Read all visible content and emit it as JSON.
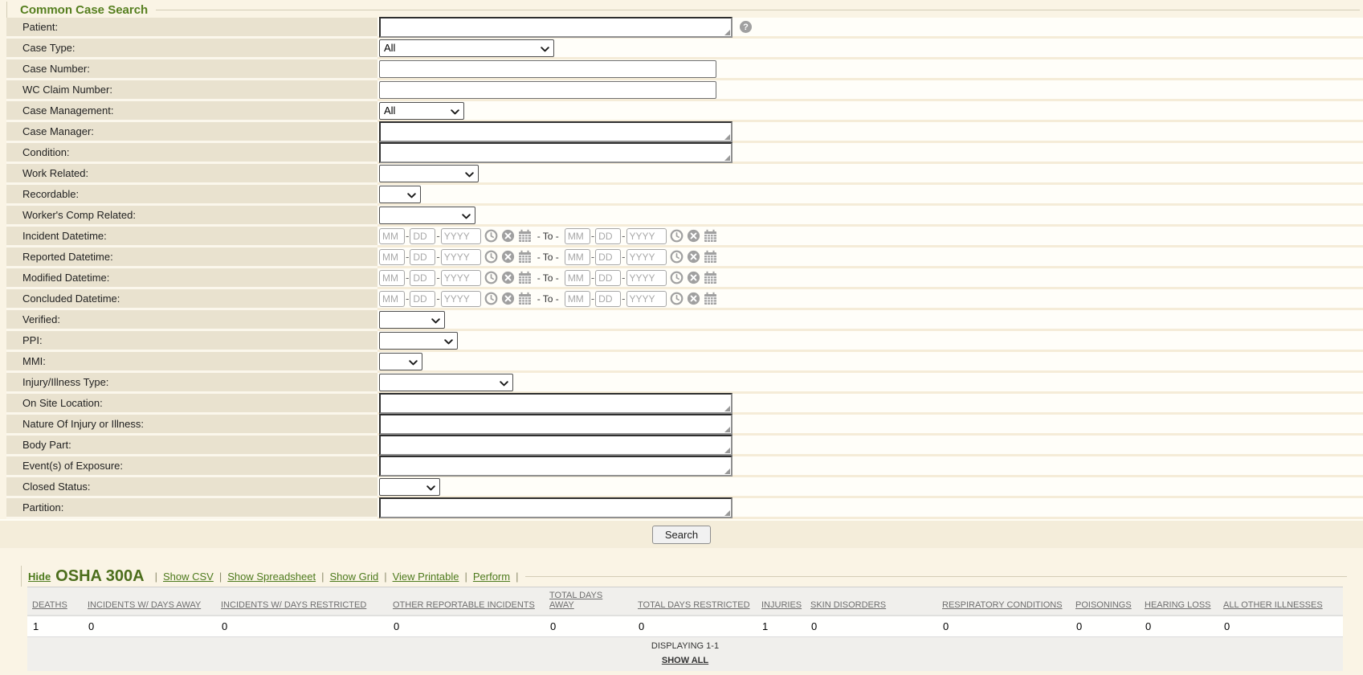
{
  "header": {
    "title": "Common Case Search"
  },
  "form": {
    "search_button": "Search",
    "help_icon": "?",
    "date_placeholders": {
      "mm": "MM",
      "dd": "DD",
      "yyyy": "YYYY"
    },
    "date_separator": "- To -",
    "dash": "-",
    "rows": [
      {
        "id": "patient",
        "label": "Patient:",
        "type": "textarea",
        "value": "",
        "help": true
      },
      {
        "id": "case_type",
        "label": "Case Type:",
        "type": "select",
        "value": "All"
      },
      {
        "id": "case_number",
        "label": "Case Number:",
        "type": "input",
        "value": ""
      },
      {
        "id": "wc_claim_number",
        "label": "WC Claim Number:",
        "type": "input",
        "value": ""
      },
      {
        "id": "case_management",
        "label": "Case Management:",
        "type": "select",
        "value": "All"
      },
      {
        "id": "case_manager",
        "label": "Case Manager:",
        "type": "textarea",
        "value": ""
      },
      {
        "id": "condition",
        "label": "Condition:",
        "type": "textarea",
        "value": ""
      },
      {
        "id": "work_related",
        "label": "Work Related:",
        "type": "select",
        "value": ""
      },
      {
        "id": "recordable",
        "label": "Recordable:",
        "type": "select",
        "value": ""
      },
      {
        "id": "workers_comp_related",
        "label": "Worker's Comp Related:",
        "type": "select",
        "value": ""
      },
      {
        "id": "incident_datetime",
        "label": "Incident Datetime:",
        "type": "daterange"
      },
      {
        "id": "reported_datetime",
        "label": "Reported Datetime:",
        "type": "daterange"
      },
      {
        "id": "modified_datetime",
        "label": "Modified Datetime:",
        "type": "daterange"
      },
      {
        "id": "concluded_datetime",
        "label": "Concluded Datetime:",
        "type": "daterange"
      },
      {
        "id": "verified",
        "label": "Verified:",
        "type": "select",
        "value": ""
      },
      {
        "id": "ppi",
        "label": "PPI:",
        "type": "select",
        "value": ""
      },
      {
        "id": "mmi",
        "label": "MMI:",
        "type": "select",
        "value": ""
      },
      {
        "id": "injury_illness_type",
        "label": "Injury/Illness Type:",
        "type": "select",
        "value": ""
      },
      {
        "id": "on_site_location",
        "label": "On Site Location:",
        "type": "textarea",
        "value": ""
      },
      {
        "id": "nature_of_injury",
        "label": "Nature Of Injury or Illness:",
        "type": "textarea",
        "value": ""
      },
      {
        "id": "body_part",
        "label": "Body Part:",
        "type": "textarea",
        "value": ""
      },
      {
        "id": "events_of_exposure",
        "label": "Event(s) of Exposure:",
        "type": "textarea",
        "value": ""
      },
      {
        "id": "closed_status",
        "label": "Closed Status:",
        "type": "select",
        "value": ""
      },
      {
        "id": "partition",
        "label": "Partition:",
        "type": "textarea",
        "value": ""
      }
    ]
  },
  "osha": {
    "hide_label": "Hide",
    "title": "OSHA 300A",
    "separator": "|",
    "links": [
      "Show CSV",
      "Show Spreadsheet",
      "Show Grid",
      "View Printable",
      "Perform"
    ],
    "table": {
      "columns": [
        "DEATHS",
        "INCIDENTS W/ DAYS AWAY",
        "INCIDENTS W/ DAYS RESTRICTED",
        "OTHER REPORTABLE INCIDENTS",
        "TOTAL DAYS AWAY",
        "TOTAL DAYS RESTRICTED",
        "INJURIES",
        "SKIN DISORDERS",
        "RESPIRATORY CONDITIONS",
        "POISONINGS",
        "HEARING LOSS",
        "ALL OTHER ILLNESSES"
      ],
      "rows": [
        [
          "1",
          "0",
          "0",
          "0",
          "0",
          "0",
          "1",
          "0",
          "0",
          "0",
          "0",
          "0"
        ]
      ],
      "displaying": "DISPLAYING 1-1",
      "show_all": "SHOW ALL"
    }
  },
  "colors": {
    "accent_green": "#567f1f",
    "title_green": "#4c6e1c",
    "link_green": "#4d7a1d",
    "label_bg": "#e9e2cf",
    "page_bg": "#faf4e5",
    "header_link_gray": "#6e6e6e"
  }
}
